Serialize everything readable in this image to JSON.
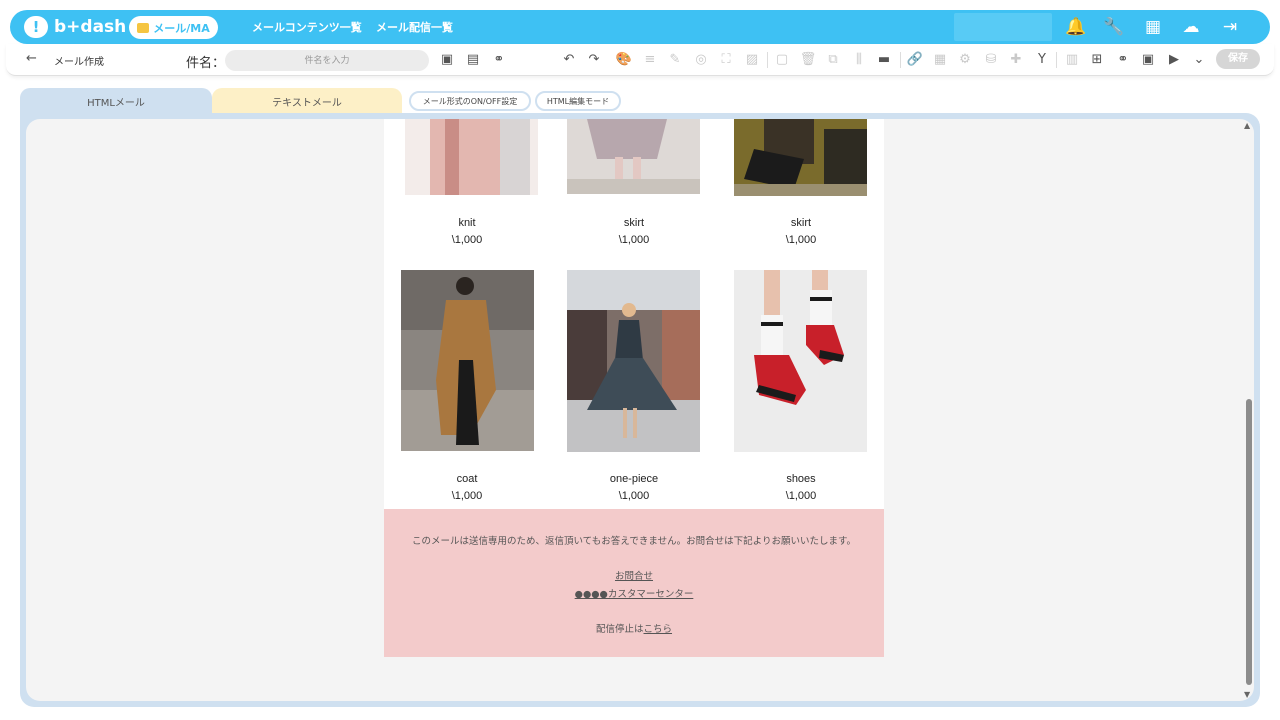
{
  "navbar": {
    "logo_text": "b+dash",
    "ma_label": "メール/MA",
    "links": [
      "メールコンテンツ一覧",
      "メール配信一覧"
    ]
  },
  "toolbar": {
    "page_title": "メール作成",
    "subject_label": "件名：",
    "subject_placeholder": "件名を入力",
    "save_label": "保存"
  },
  "tabs": {
    "html_label": "HTMLメール",
    "text_label": "テキストメール",
    "format_toggle_label": "メール形式のON/OFF設定",
    "html_edit_mode_label": "HTML編集モード"
  },
  "products": [
    {
      "name": "knit",
      "price": "\\1,000",
      "colors": [
        "#e8c9c4",
        "#c98d86"
      ]
    },
    {
      "name": "skirt",
      "price": "\\1,000",
      "colors": [
        "#cfc7c9",
        "#a89a9f"
      ]
    },
    {
      "name": "skirt",
      "price": "\\1,000",
      "colors": [
        "#6a5b2a",
        "#1d1d1d"
      ]
    },
    {
      "name": "coat",
      "price": "\\1,000",
      "colors": [
        "#a97b4a",
        "#5a4a3d"
      ]
    },
    {
      "name": "one-piece",
      "price": "\\1,000",
      "colors": [
        "#4a5a6b",
        "#2f3a44"
      ]
    },
    {
      "name": "shoes",
      "price": "\\1,000",
      "colors": [
        "#e8e8e8",
        "#c8202a"
      ]
    }
  ],
  "footer": {
    "notice": "このメールは送信専用のため、返信頂いてもお答えできません。お問合せは下記よりお願いいたします。",
    "contact_link": "お問合せ",
    "center_link": "●●●●カスタマーセンター",
    "unsubscribe_prefix": "配信停止は",
    "unsubscribe_link": "こちら"
  },
  "colors": {
    "brand": "#3ec1f3",
    "footer_bg": "#f3cbcb",
    "html_tab": "#cfe0f0",
    "text_tab": "#fdf0c7"
  }
}
